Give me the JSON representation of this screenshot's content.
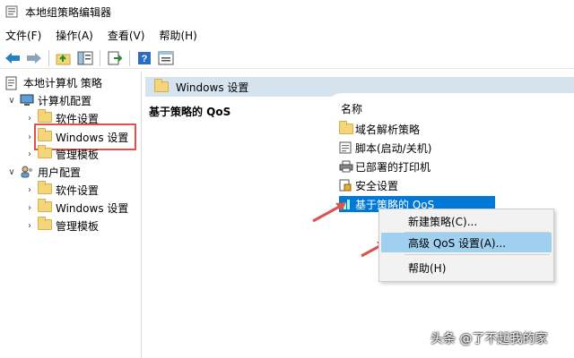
{
  "window": {
    "title": "本地组策略编辑器"
  },
  "menubar": {
    "items": [
      "文件(F)",
      "操作(A)",
      "查看(V)",
      "帮助(H)"
    ]
  },
  "toolbar": {
    "buttons": [
      "back-icon",
      "forward-icon",
      "up-folder-icon",
      "show-hide-tree-icon",
      "export-list-icon",
      "help-icon",
      "properties-icon"
    ]
  },
  "tree": {
    "root": "本地计算机 策略",
    "computer_config": "计算机配置",
    "cc_software": "软件设置",
    "cc_windows": "Windows 设置",
    "cc_admin": "管理模板",
    "user_config": "用户配置",
    "uc_software": "软件设置",
    "uc_windows": "Windows 设置",
    "uc_admin": "管理模板"
  },
  "main": {
    "header": "Windows 设置",
    "description_title": "基于策略的 QoS",
    "column_name": "名称",
    "items": [
      {
        "label": "域名解析策略",
        "icon": "folder-icon"
      },
      {
        "label": "脚本(启动/关机)",
        "icon": "script-icon"
      },
      {
        "label": "已部署的打印机",
        "icon": "printer-icon"
      },
      {
        "label": "安全设置",
        "icon": "security-icon"
      },
      {
        "label": "基于策略的 QoS",
        "icon": "qos-chart-icon"
      }
    ]
  },
  "context_menu": {
    "items": [
      "新建策略(C)...",
      "高级 QoS 设置(A)...",
      "帮助(H)"
    ]
  },
  "watermark": "头条 @了不起我的家",
  "colors": {
    "selection": "#0078d7",
    "header_bar": "#d6e4f0",
    "menu_hover": "#9fd0f0",
    "annotation_red": "#d9534f",
    "folder": "#f3d67a"
  }
}
